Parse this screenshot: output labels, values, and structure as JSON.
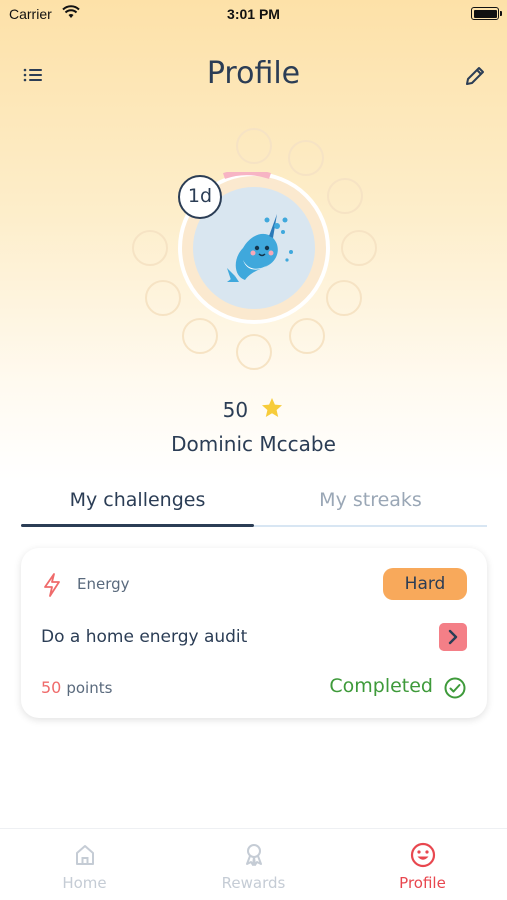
{
  "status_bar": {
    "carrier": "Carrier",
    "time": "3:01 PM"
  },
  "header": {
    "title": "Profile",
    "menu_icon": "menu-icon",
    "edit_icon": "pencil-icon"
  },
  "avatar": {
    "streak_badge": "1d",
    "mascot": "narwhal-icon",
    "progress_color": "#f7b4c4"
  },
  "profile": {
    "points": "50",
    "name": "Dominic Mccabe"
  },
  "tabs": [
    {
      "label": "My challenges",
      "active": true
    },
    {
      "label": "My streaks",
      "active": false
    }
  ],
  "challenge_card": {
    "category": "Energy",
    "category_icon": "lightning-icon",
    "difficulty": "Hard",
    "title": "Do a home energy audit",
    "points_value": "50",
    "points_label": "points",
    "status": "Completed",
    "status_icon": "check-circle-icon"
  },
  "bottom_nav": [
    {
      "label": "Home",
      "icon": "home-icon",
      "active": false
    },
    {
      "label": "Rewards",
      "icon": "medal-icon",
      "active": false
    },
    {
      "label": "Profile",
      "icon": "smiley-icon",
      "active": true
    }
  ],
  "colors": {
    "accent": "#e8474f",
    "text_dark": "#2b3d55",
    "difficulty_bg": "#f8a95b",
    "completed": "#3e9a3a"
  }
}
